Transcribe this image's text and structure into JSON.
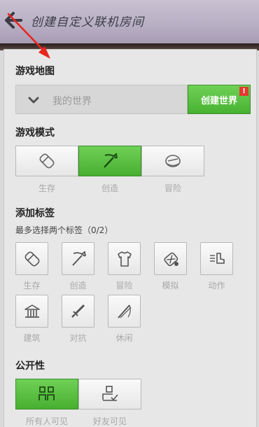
{
  "header": {
    "title": "创建自定义联机房间",
    "back_icon": "back-arrow-icon"
  },
  "map": {
    "section_title": "游戏地图",
    "placeholder": "我的世界",
    "create_label": "创建世界",
    "badge": "!"
  },
  "mode": {
    "section_title": "游戏模式",
    "items": [
      {
        "label": "生存",
        "icon": "eraser-icon",
        "active": false
      },
      {
        "label": "创造",
        "icon": "pickaxe-icon",
        "active": true
      },
      {
        "label": "冒险",
        "icon": "compass-icon",
        "active": false
      }
    ]
  },
  "tags": {
    "section_title": "添加标签",
    "hint": "最多选择两个标签（0/2）",
    "items": [
      {
        "label": "生存",
        "icon": "eraser-icon"
      },
      {
        "label": "创造",
        "icon": "pickaxe-icon"
      },
      {
        "label": "冒险",
        "icon": "armor-icon"
      },
      {
        "label": "模拟",
        "icon": "tnt-icon"
      },
      {
        "label": "动作",
        "icon": "boot-icon"
      },
      {
        "label": "建筑",
        "icon": "building-icon"
      },
      {
        "label": "对抗",
        "icon": "sword-icon"
      },
      {
        "label": "休闲",
        "icon": "fishing-rod-icon"
      }
    ]
  },
  "visibility": {
    "section_title": "公开性",
    "items": [
      {
        "label": "所有人可见",
        "icon": "people-icon",
        "active": true
      },
      {
        "label": "好友可见",
        "icon": "friend-icon",
        "active": false
      }
    ]
  },
  "colors": {
    "accent": "#4cb535",
    "badge": "#e23a2e",
    "header": "#b7aec3"
  }
}
